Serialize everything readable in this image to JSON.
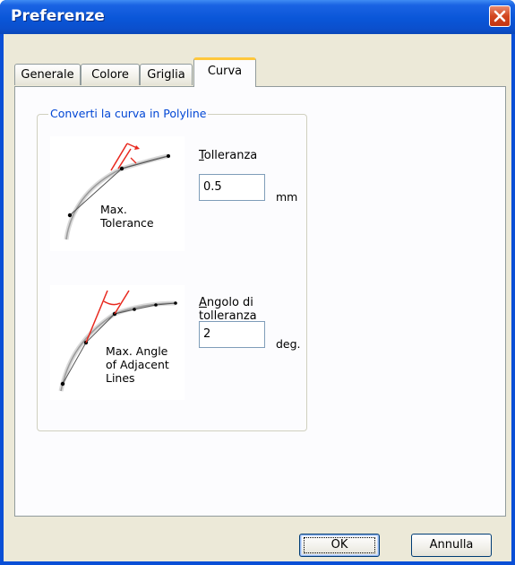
{
  "window": {
    "title": "Preferenze"
  },
  "tabs": [
    {
      "label": "Generale",
      "active": false
    },
    {
      "label": "Colore",
      "active": false
    },
    {
      "label": "Griglia",
      "active": false
    },
    {
      "label": "Curva",
      "active": true
    }
  ],
  "group": {
    "title": "Converti la curva in Polyline",
    "tolerance": {
      "illustration_line1": "Max.",
      "illustration_line2": "Tolerance",
      "label_first": "T",
      "label_rest": "olleranza",
      "value": "0.5",
      "unit": "mm"
    },
    "angle": {
      "illustration_line1": "Max. Angle",
      "illustration_line2": "of Adjacent",
      "illustration_line3": "Lines",
      "label_first": "A",
      "label_rest": "ngolo di tolleranza",
      "value": "2",
      "unit": "deg."
    }
  },
  "buttons": {
    "ok": "OK",
    "cancel": "Annulla"
  },
  "colors": {
    "titlebar": "#0a56d8",
    "tab_highlight": "#ffc83c",
    "group_title": "#0046d5",
    "dialog_bg": "#ece9d8",
    "accent_red": "#e8281e"
  }
}
